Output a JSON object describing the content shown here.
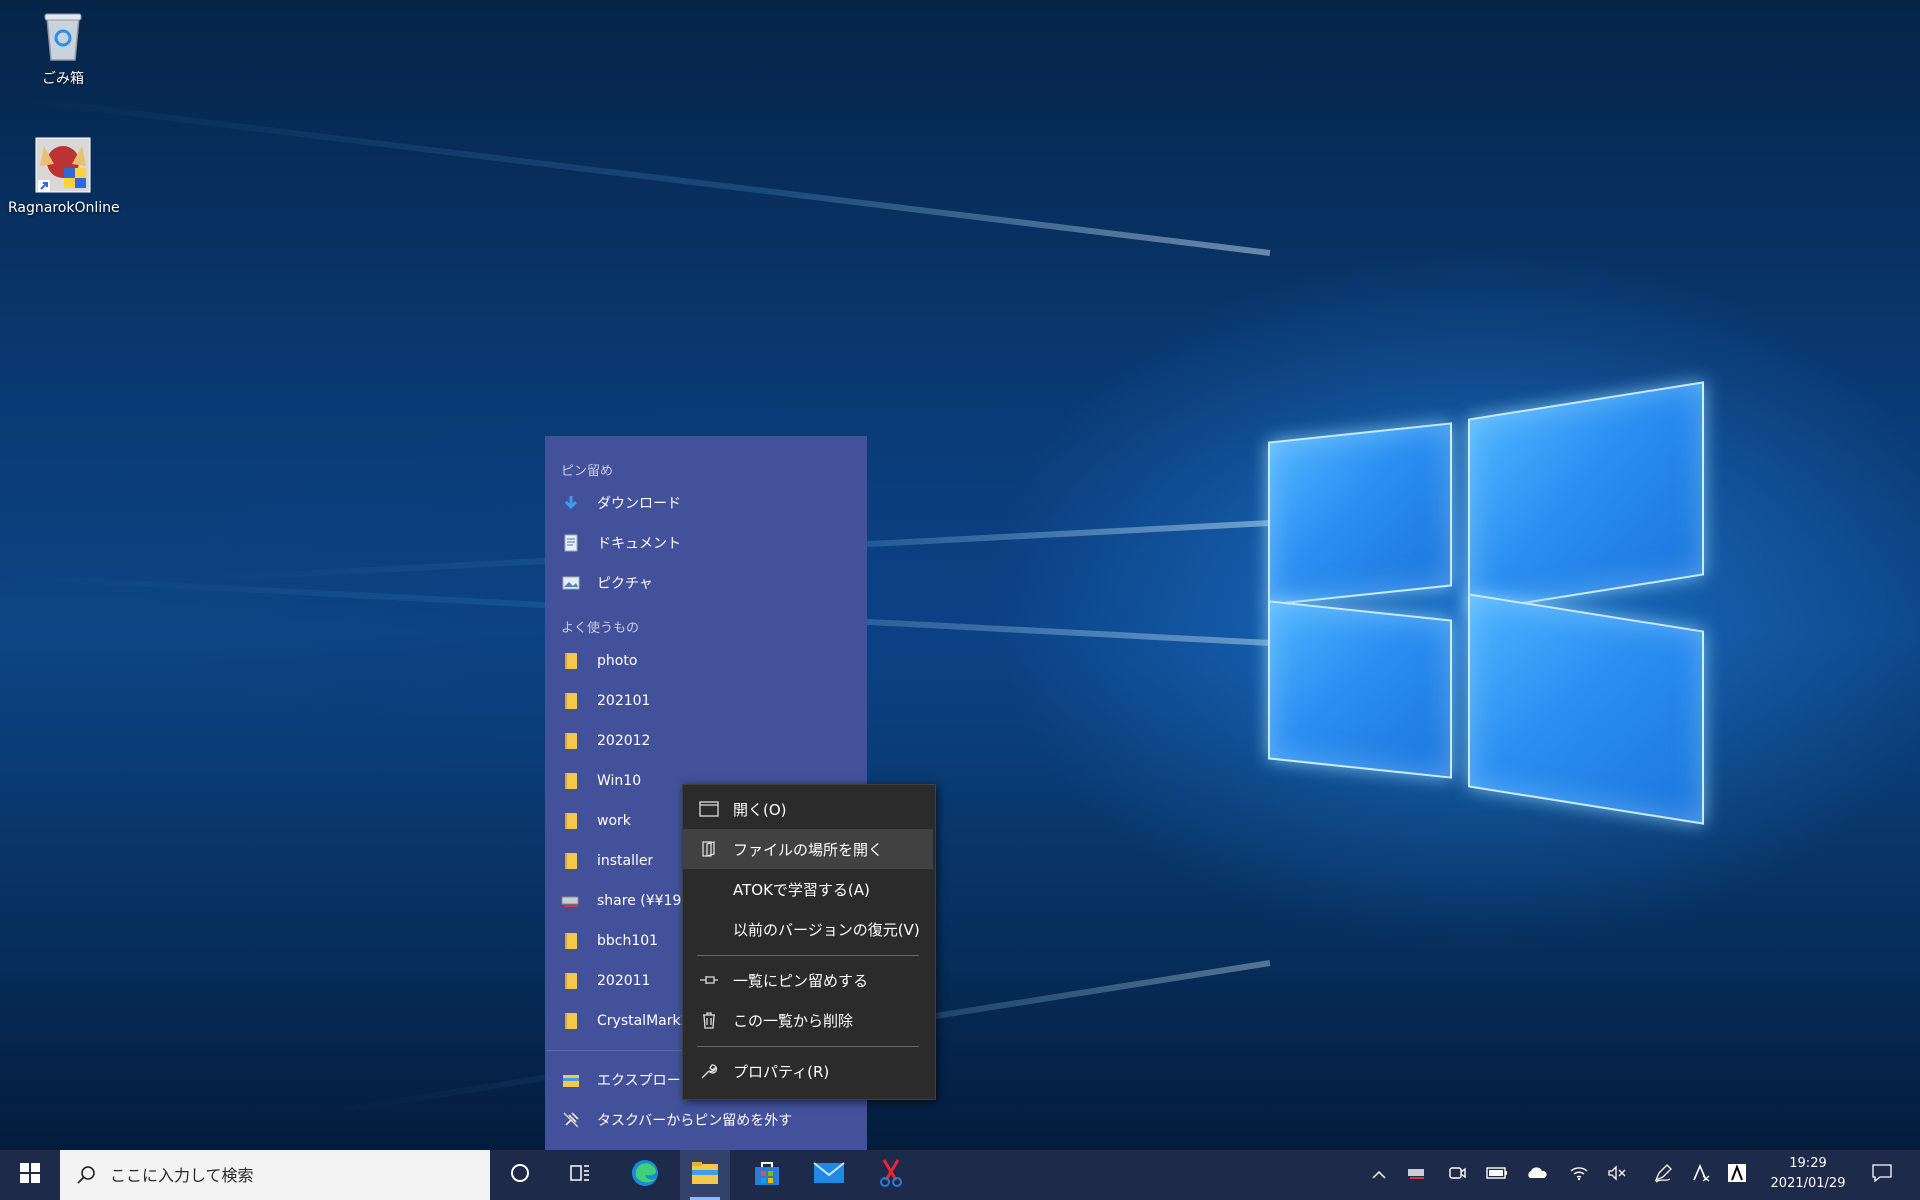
{
  "desktop": {
    "icons": [
      {
        "label": "ごみ箱",
        "icon": "recycle-bin-icon"
      },
      {
        "label": "RagnarokOnline",
        "icon": "app-shortcut-icon"
      }
    ]
  },
  "jumplist": {
    "pinned_header": "ピン留め",
    "pinned": [
      {
        "label": "ダウンロード",
        "icon": "download-icon"
      },
      {
        "label": "ドキュメント",
        "icon": "document-icon"
      },
      {
        "label": "ピクチャ",
        "icon": "pictures-icon"
      }
    ],
    "frequent_header": "よく使うもの",
    "frequent": [
      {
        "label": "photo",
        "icon": "folder-icon"
      },
      {
        "label": "202101",
        "icon": "folder-icon"
      },
      {
        "label": "202012",
        "icon": "folder-icon"
      },
      {
        "label": "Win10",
        "icon": "folder-icon"
      },
      {
        "label": "work",
        "icon": "folder-icon"
      },
      {
        "label": "installer",
        "icon": "folder-icon"
      },
      {
        "label": "share (¥¥192",
        "icon": "network-drive-icon"
      },
      {
        "label": "bbch101",
        "icon": "folder-icon"
      },
      {
        "label": "202011",
        "icon": "folder-icon"
      },
      {
        "label": "CrystalMark2",
        "icon": "folder-icon"
      }
    ],
    "actions": [
      {
        "label": "エクスプローラー",
        "icon": "file-explorer-icon"
      },
      {
        "label": "タスクバーからピン留めを外す",
        "icon": "unpin-icon"
      }
    ]
  },
  "context_menu": {
    "items": [
      {
        "label": "開く(O)",
        "icon": "window-icon"
      },
      {
        "label": "ファイルの場所を開く",
        "icon": "open-location-icon"
      },
      {
        "label": "ATOKで学習する(A)",
        "icon": ""
      },
      {
        "label": "以前のバージョンの復元(V)",
        "icon": ""
      },
      {
        "label": "一覧にピン留めする",
        "icon": "pin-icon"
      },
      {
        "label": "この一覧から削除",
        "icon": "trash-icon"
      },
      {
        "label": "プロパティ(R)",
        "icon": "wrench-icon"
      }
    ],
    "highlighted_index": 1
  },
  "taskbar": {
    "search_placeholder": "ここに入力して検索",
    "clock_time": "19:29",
    "clock_date": "2021/01/29",
    "pinned_apps": [
      "cortana-icon",
      "task-view-icon",
      "edge-icon",
      "file-explorer-icon",
      "store-icon",
      "mail-icon",
      "snipping-tool-icon"
    ],
    "tray": [
      "show-hidden-icons-icon",
      "network-drive-tray-icon",
      "meet-now-icon",
      "battery-icon",
      "onedrive-icon",
      "wifi-icon",
      "volume-muted-icon",
      "pen-icon",
      "atok-icon",
      "ime-icon",
      "notification-icon"
    ]
  }
}
